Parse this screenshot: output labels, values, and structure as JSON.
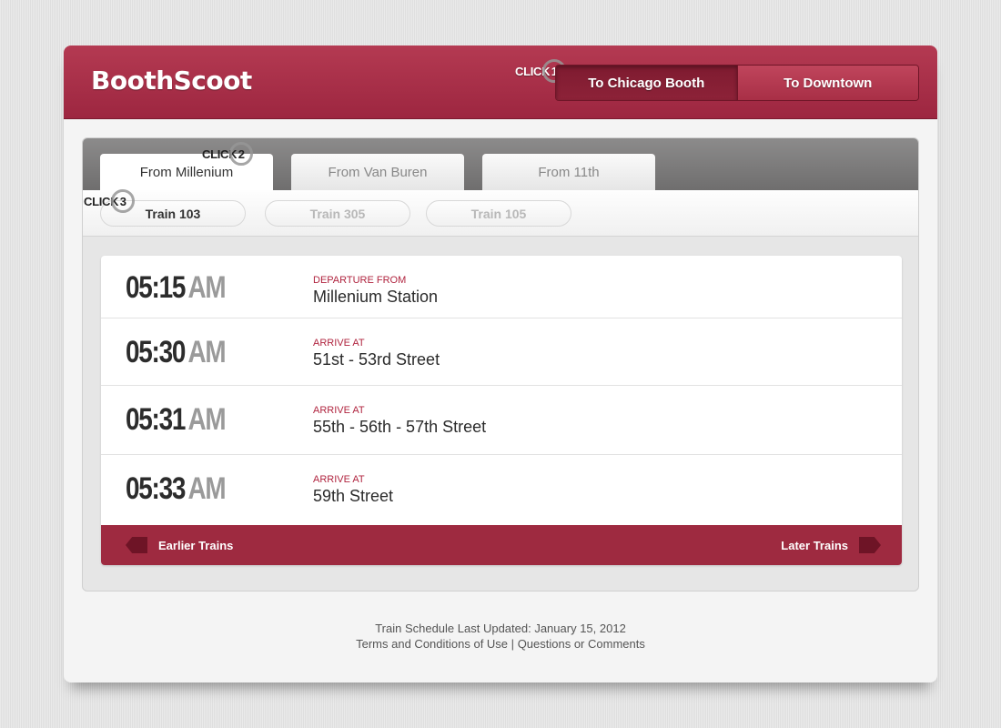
{
  "header": {
    "brand": "BoothScoot",
    "direction_options": [
      {
        "label": "To Chicago Booth",
        "active": true
      },
      {
        "label": "To Downtown",
        "active": false
      }
    ]
  },
  "annotations": {
    "click1": {
      "text": "CLICK",
      "number": "1"
    },
    "click2": {
      "text": "CLICK",
      "number": "2"
    },
    "click3": {
      "text": "CLICK",
      "number": "3"
    }
  },
  "station_tabs": [
    {
      "label": "From  Millenium",
      "active": true
    },
    {
      "label": "From  Van Buren",
      "active": false
    },
    {
      "label": "From 11th",
      "active": false
    }
  ],
  "trains": [
    {
      "label": "Train 103",
      "active": true
    },
    {
      "label": "Train 305",
      "active": false
    },
    {
      "label": "Train 105",
      "active": false
    }
  ],
  "schedule": [
    {
      "time": "05:15",
      "ampm": "AM",
      "kind": "DEPARTURE FROM",
      "stop": "Millenium Station"
    },
    {
      "time": "05:30",
      "ampm": "AM",
      "kind": "ARRIVE AT",
      "stop": "51st - 53rd Street"
    },
    {
      "time": "05:31",
      "ampm": "AM",
      "kind": "ARRIVE AT",
      "stop": "55th - 56th - 57th Street"
    },
    {
      "time": "05:33",
      "ampm": "AM",
      "kind": "ARRIVE AT",
      "stop": "59th Street"
    }
  ],
  "nav": {
    "earlier": "Earlier Trains",
    "later": "Later Trains"
  },
  "footer": {
    "updated": "Train Schedule Last Updated: January 15, 2012",
    "terms": "Terms and Conditions of Use",
    "separator": "|",
    "questions": "Questions or Comments"
  },
  "colors": {
    "brand_red": "#9d2640",
    "accent_red": "#b0243f",
    "nav_red": "#9e2a40"
  }
}
